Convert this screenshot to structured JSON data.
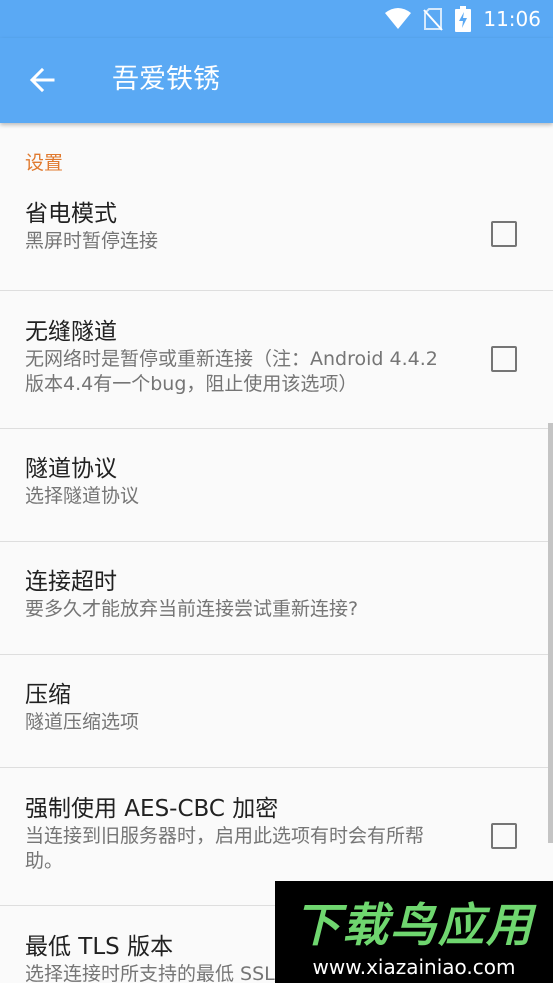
{
  "status_bar": {
    "time": "11:06",
    "icons": [
      "wifi-icon",
      "no-sim-icon",
      "battery-charging-icon"
    ]
  },
  "app_bar": {
    "title": "吾爱铁锈",
    "back_icon": "arrow-left-icon"
  },
  "settings": {
    "section_title": "设置",
    "items": [
      {
        "title": "省电模式",
        "summary": "黑屏时暂停连接",
        "checkbox": true,
        "checked": false
      },
      {
        "title": "无缝隧道",
        "summary": "无网络时是暂停或重新连接（注：Android 4.4.2版本4.4有一个bug，阻止使用该选项）",
        "checkbox": true,
        "checked": false
      },
      {
        "title": "隧道协议",
        "summary": "选择隧道协议",
        "checkbox": false
      },
      {
        "title": "连接超时",
        "summary": "要多久才能放弃当前连接尝试重新连接?",
        "checkbox": false
      },
      {
        "title": "压缩",
        "summary": "隧道压缩选项",
        "checkbox": false
      },
      {
        "title": "强制使用 AES-CBC 加密",
        "summary": "当连接到旧服务器时，启用此选项有时会有所帮助。",
        "checkbox": true,
        "checked": false
      },
      {
        "title": "最低 TLS 版本",
        "summary": "选择连接时所支持的最低 SSL/TLS 版本",
        "checkbox": false
      }
    ]
  },
  "watermark": {
    "logo_text": "下载鸟应用",
    "url": "www.xiazainiao.com"
  },
  "colors": {
    "app_bar": "#5aa9f4",
    "section_header": "#e07a2f",
    "background": "#fafafa"
  }
}
